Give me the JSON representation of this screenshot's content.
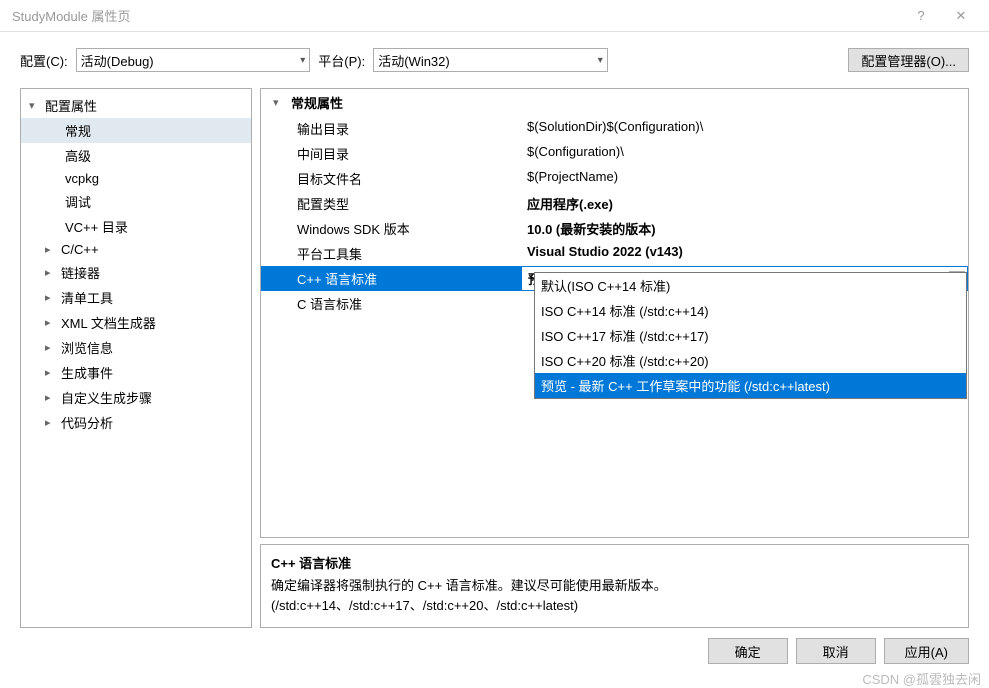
{
  "titlebar": {
    "title": "StudyModule 属性页",
    "help": "?",
    "close": "✕"
  },
  "config": {
    "config_label": "配置(C):",
    "config_value": "活动(Debug)",
    "platform_label": "平台(P):",
    "platform_value": "活动(Win32)",
    "manager_btn": "配置管理器(O)..."
  },
  "tree": {
    "root": "配置属性",
    "children": [
      "常规",
      "高级",
      "vcpkg",
      "调试",
      "VC++ 目录"
    ],
    "collapsed": [
      "C/C++",
      "链接器",
      "清单工具",
      "XML 文档生成器",
      "浏览信息",
      "生成事件",
      "自定义生成步骤",
      "代码分析"
    ]
  },
  "props": {
    "header": "常规属性",
    "rows": [
      {
        "name": "输出目录",
        "value": "$(SolutionDir)$(Configuration)\\",
        "bold": false
      },
      {
        "name": "中间目录",
        "value": "$(Configuration)\\",
        "bold": false
      },
      {
        "name": "目标文件名",
        "value": "$(ProjectName)",
        "bold": false
      },
      {
        "name": "配置类型",
        "value": "应用程序(.exe)",
        "bold": true
      },
      {
        "name": "Windows SDK 版本",
        "value": "10.0 (最新安装的版本)",
        "bold": true
      },
      {
        "name": "平台工具集",
        "value": "Visual Studio 2022 (v143)",
        "bold": true
      },
      {
        "name": "C++ 语言标准",
        "value": "预览 - 最新 C++ 工作草案中的功能 (/std:c++latest)",
        "bold": true,
        "selected": true
      },
      {
        "name": "C 语言标准",
        "value": "",
        "bold": false
      }
    ],
    "dropdown_options": [
      "默认(ISO C++14 标准)",
      "ISO C++14 标准 (/std:c++14)",
      "ISO C++17 标准 (/std:c++17)",
      "ISO C++20 标准 (/std:c++20)",
      "预览 - 最新 C++ 工作草案中的功能 (/std:c++latest)"
    ]
  },
  "desc": {
    "title": "C++ 语言标准",
    "text": "确定编译器将强制执行的 C++ 语言标准。建议尽可能使用最新版本。(/std:c++14、/std:c++17、/std:c++20、/std:c++latest)"
  },
  "buttons": {
    "ok": "确定",
    "cancel": "取消",
    "apply": "应用(A)"
  },
  "watermark": "CSDN @孤雲独去闲"
}
